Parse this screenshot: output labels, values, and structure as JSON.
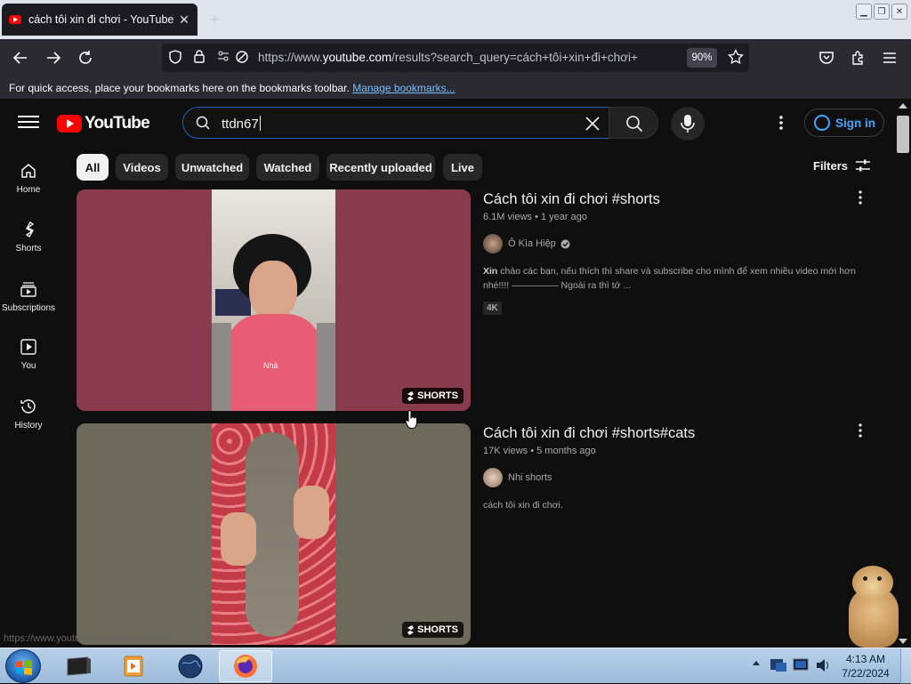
{
  "browser": {
    "tab_title": "cách tôi xin đi chơi - YouTube",
    "url_host": "https://www.",
    "url_domain": "youtube.com",
    "url_path": "/results?search_query=cách+tôi+xin+đi+chơi+",
    "zoom": "90%",
    "bookmarks_message": "For quick access, place your bookmarks here on the bookmarks toolbar.",
    "bookmarks_link": "Manage bookmarks..."
  },
  "youtube": {
    "logo_text": "YouTube",
    "search_value": "ttdn67",
    "signin_label": "Sign in",
    "rail": [
      {
        "label": "Home",
        "icon": "home-icon"
      },
      {
        "label": "Shorts",
        "icon": "shorts-icon"
      },
      {
        "label": "Subscriptions",
        "icon": "subscriptions-icon"
      },
      {
        "label": "You",
        "icon": "you-icon"
      },
      {
        "label": "History",
        "icon": "history-icon"
      }
    ],
    "chips": [
      "All",
      "Videos",
      "Unwatched",
      "Watched",
      "Recently uploaded",
      "Live"
    ],
    "filters_label": "Filters",
    "results": [
      {
        "title": "Cách tôi xin đi chơi #shorts",
        "views": "6.1M views",
        "age": "1 year ago",
        "channel": "Ô Kìa Hiệp",
        "verified": true,
        "desc_bold": "Xin",
        "desc": " chào các bạn, nếu thích thì share và subscribe cho mình để xem nhiều video mới hơn nhé!!!! ————— Ngoài ra thì tớ ...",
        "tag": "4K",
        "badge": "SHORTS",
        "overlay_text": "Nhà"
      },
      {
        "title": "Cách tôi xin đi chơi #shorts#cats",
        "views": "17K views",
        "age": "5 months ago",
        "channel": "Nhi shorts",
        "verified": false,
        "desc_bold": "",
        "desc": "cách tôi xin đi chơi.",
        "tag": "",
        "badge": "SHORTS"
      }
    ],
    "status_url": "https://www.youtube.com/shorts/Zu6R..."
  },
  "taskbar": {
    "time": "4:13 AM",
    "date": "7/22/2024"
  },
  "colors": {
    "yt_bg": "#0f0f0f",
    "yt_red": "#ff0000",
    "link_blue": "#3ea6ff",
    "search_focus": "#1c62b9"
  }
}
